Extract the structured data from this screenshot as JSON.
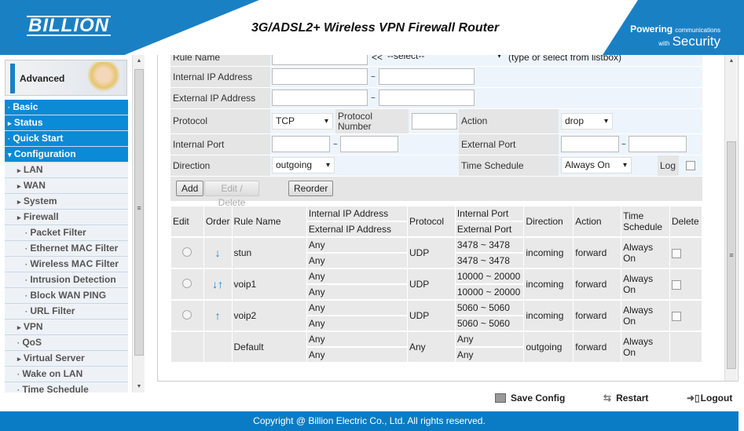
{
  "header": {
    "logo": "BILLION",
    "title": "3G/ADSL2+ Wireless VPN Firewall Router",
    "slogan_1": "Powering",
    "slogan_2": "communications",
    "slogan_3": "with",
    "slogan_4": "Security"
  },
  "sidebar": {
    "mode": "Advanced",
    "items": [
      {
        "label": "Basic",
        "level": "top",
        "marker": "·"
      },
      {
        "label": "Status",
        "level": "top",
        "marker": "▸"
      },
      {
        "label": "Quick Start",
        "level": "top",
        "marker": "·"
      },
      {
        "label": "Configuration",
        "level": "top",
        "marker": "▾"
      },
      {
        "label": "LAN",
        "level": "l1",
        "marker": "▸"
      },
      {
        "label": "WAN",
        "level": "l1",
        "marker": "▸"
      },
      {
        "label": "System",
        "level": "l1",
        "marker": "▸"
      },
      {
        "label": "Firewall",
        "level": "l1",
        "marker": "▸"
      },
      {
        "label": "Packet Filter",
        "level": "l2",
        "marker": "·"
      },
      {
        "label": "Ethernet MAC Filter",
        "level": "l2",
        "marker": "·"
      },
      {
        "label": "Wireless MAC Filter",
        "level": "l2",
        "marker": "·"
      },
      {
        "label": "Intrusion Detection",
        "level": "l2",
        "marker": "·"
      },
      {
        "label": "Block WAN PING",
        "level": "l2",
        "marker": "·"
      },
      {
        "label": "URL Filter",
        "level": "l2",
        "marker": "·"
      },
      {
        "label": "VPN",
        "level": "l1",
        "marker": "▸"
      },
      {
        "label": "QoS",
        "level": "l1",
        "marker": "·"
      },
      {
        "label": "Virtual Server",
        "level": "l1",
        "marker": "▸"
      },
      {
        "label": "Wake on LAN",
        "level": "l1",
        "marker": "·"
      },
      {
        "label": "Time Schedule",
        "level": "l1",
        "marker": "·"
      }
    ]
  },
  "form": {
    "rule_name_label": "Rule Name",
    "rule_name_sep": "<<",
    "rule_select": "--select--",
    "rule_hint": "(type or select from listbox)",
    "internal_ip_label": "Internal IP Address",
    "external_ip_label": "External IP Address",
    "tilde": "~",
    "protocol_label": "Protocol",
    "protocol_value": "TCP",
    "protocol_number_label": "Protocol Number",
    "action_label": "Action",
    "action_value": "drop",
    "internal_port_label": "Internal Port",
    "external_port_label": "External Port",
    "direction_label": "Direction",
    "direction_value": "outgoing",
    "time_schedule_label": "Time Schedule",
    "time_schedule_value": "Always On",
    "log_label": "Log",
    "add": "Add",
    "edit_delete": "Edit / Delete",
    "reorder": "Reorder"
  },
  "table": {
    "headers": {
      "edit": "Edit",
      "order": "Order",
      "rule_name": "Rule Name",
      "internal_ip": "Internal IP Address",
      "external_ip": "External IP Address",
      "protocol": "Protocol",
      "internal_port": "Internal Port",
      "external_port": "External Port",
      "direction": "Direction",
      "action": "Action",
      "time_schedule": "Time Schedule",
      "delete": "Delete"
    },
    "rows": [
      {
        "order": "↓",
        "name": "stun",
        "int_ip": "Any",
        "ext_ip": "Any",
        "protocol": "UDP",
        "int_port": "3478 ~ 3478",
        "ext_port": "3478 ~ 3478",
        "direction": "incoming",
        "action": "forward",
        "schedule": "Always On"
      },
      {
        "order": "↓↑",
        "name": "voip1",
        "int_ip": "Any",
        "ext_ip": "Any",
        "protocol": "UDP",
        "int_port": "10000 ~ 20000",
        "ext_port": "10000 ~ 20000",
        "direction": "incoming",
        "action": "forward",
        "schedule": "Always On"
      },
      {
        "order": "↑",
        "name": "voip2",
        "int_ip": "Any",
        "ext_ip": "Any",
        "protocol": "UDP",
        "int_port": "5060 ~ 5060",
        "ext_port": "5060 ~ 5060",
        "direction": "incoming",
        "action": "forward",
        "schedule": "Always On"
      },
      {
        "order": "",
        "name": "Default",
        "int_ip": "Any",
        "ext_ip": "Any",
        "protocol": "Any",
        "int_port": "Any",
        "ext_port": "Any",
        "direction": "outgoing",
        "action": "forward",
        "schedule": "Always On"
      }
    ]
  },
  "bottom": {
    "save": "Save Config",
    "restart": "Restart",
    "logout": "Logout"
  },
  "footer": "Copyright @ Billion Electric Co., Ltd. All rights reserved.",
  "colors": {
    "brand_blue": "#1a80c4",
    "menu_blue": "#0b8ad6"
  }
}
